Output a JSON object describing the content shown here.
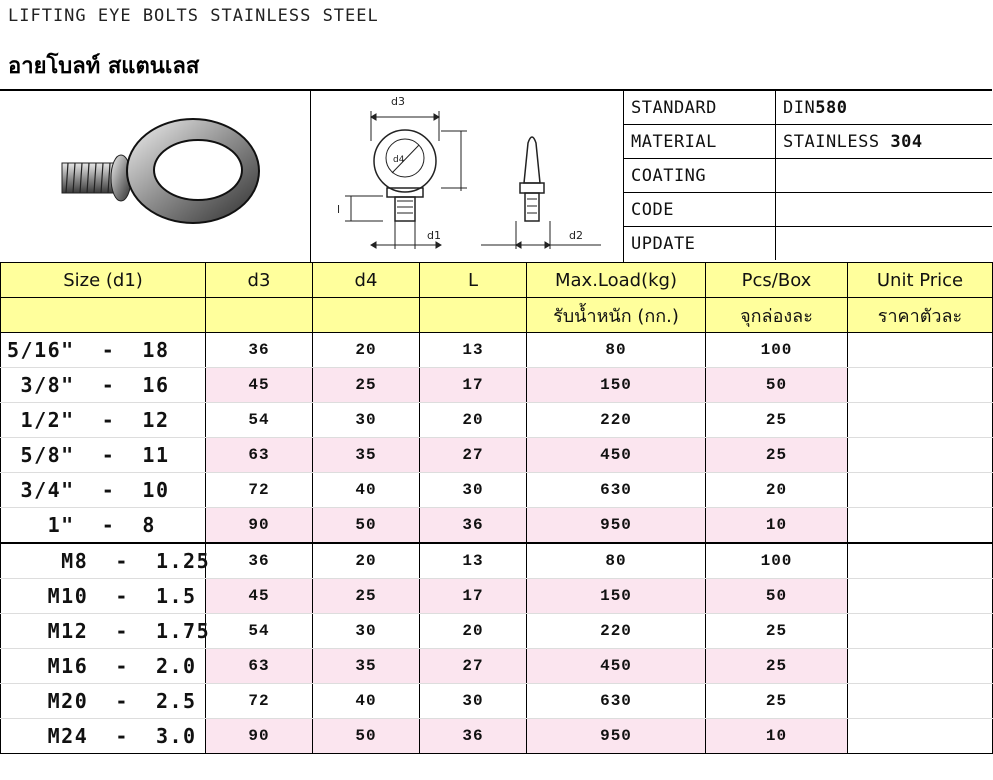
{
  "header": {
    "title_en": "LIFTING EYE BOLTS STAINLESS STEEL",
    "title_th": "อายโบลท์ สแตนเลส"
  },
  "diagram": {
    "labels": {
      "d3": "d3",
      "d4": "d4",
      "d1": "d1",
      "d2": "d2",
      "l": "l"
    }
  },
  "spec": {
    "rows": [
      {
        "key": "STANDARD",
        "value_prefix": "DIN",
        "value_bold": "580"
      },
      {
        "key": "MATERIAL",
        "value_prefix": "STAINLESS ",
        "value_bold": "304"
      },
      {
        "key": "COATING",
        "value_prefix": "",
        "value_bold": ""
      },
      {
        "key": "CODE",
        "value_prefix": "",
        "value_bold": ""
      },
      {
        "key": "UPDATE",
        "value_prefix": "",
        "value_bold": ""
      }
    ]
  },
  "table": {
    "headers": [
      "Size (d1)",
      "d3",
      "d4",
      "L",
      "Max.Load(kg)",
      "Pcs/Box",
      "Unit Price"
    ],
    "subheaders": [
      "",
      "",
      "",
      "",
      "รับน้ำหนัก (กก.)",
      "จุกล่องละ",
      "ราคาตัวละ"
    ],
    "rows": [
      {
        "size": "5/16\"  -  18",
        "d3": "36",
        "d4": "20",
        "L": "13",
        "load": "80",
        "pcs": "100",
        "price": ""
      },
      {
        "size": " 3/8\"  -  16",
        "d3": "45",
        "d4": "25",
        "L": "17",
        "load": "150",
        "pcs": "50",
        "price": ""
      },
      {
        "size": " 1/2\"  -  12",
        "d3": "54",
        "d4": "30",
        "L": "20",
        "load": "220",
        "pcs": "25",
        "price": ""
      },
      {
        "size": " 5/8\"  -  11",
        "d3": "63",
        "d4": "35",
        "L": "27",
        "load": "450",
        "pcs": "25",
        "price": ""
      },
      {
        "size": " 3/4\"  -  10",
        "d3": "72",
        "d4": "40",
        "L": "30",
        "load": "630",
        "pcs": "20",
        "price": ""
      },
      {
        "size": "   1\"  -  8",
        "d3": "90",
        "d4": "50",
        "L": "36",
        "load": "950",
        "pcs": "10",
        "price": ""
      },
      {
        "size": "    M8  -  1.25",
        "d3": "36",
        "d4": "20",
        "L": "13",
        "load": "80",
        "pcs": "100",
        "price": ""
      },
      {
        "size": "   M10  -  1.5",
        "d3": "45",
        "d4": "25",
        "L": "17",
        "load": "150",
        "pcs": "50",
        "price": ""
      },
      {
        "size": "   M12  -  1.75",
        "d3": "54",
        "d4": "30",
        "L": "20",
        "load": "220",
        "pcs": "25",
        "price": ""
      },
      {
        "size": "   M16  -  2.0",
        "d3": "63",
        "d4": "35",
        "L": "27",
        "load": "450",
        "pcs": "25",
        "price": ""
      },
      {
        "size": "   M20  -  2.5",
        "d3": "72",
        "d4": "40",
        "L": "30",
        "load": "630",
        "pcs": "25",
        "price": ""
      },
      {
        "size": "   M24  -  3.0",
        "d3": "90",
        "d4": "50",
        "L": "36",
        "load": "950",
        "pcs": "10",
        "price": ""
      }
    ]
  },
  "colors": {
    "header_bg": "#ffff9c",
    "alt_row_bg": "#fbe5ef",
    "border": "#000000"
  }
}
